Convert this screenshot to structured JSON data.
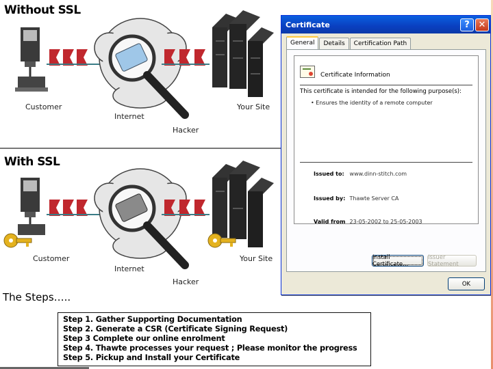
{
  "without_ssl": {
    "title": "Without SSL",
    "labels": {
      "customer": "Customer",
      "internet": "Internet",
      "hacker": "Hacker",
      "site": "Your Site"
    }
  },
  "with_ssl": {
    "title": "With SSL",
    "labels": {
      "customer": "Customer",
      "internet": "Internet",
      "hacker": "Hacker",
      "site": "Your Site"
    }
  },
  "steps": {
    "title": "The Steps…..",
    "items": [
      "Step 1. Gather Supporting Documentation",
      "Step 2. Generate a CSR (Certificate Signing Request)",
      "Step 3 Complete our online enrolment",
      "Step 4. Thawte processes your request ; Please monitor the progress",
      "Step 5. Pickup and Install your Certificate"
    ]
  },
  "dialog": {
    "title": "Certificate",
    "help_glyph": "?",
    "close_glyph": "✕",
    "tabs": [
      "General",
      "Details",
      "Certification Path"
    ],
    "info_heading": "Certificate Information",
    "purpose_label": "This certificate is intended for the following purpose(s):",
    "purpose_item": "• Ensures the identity of a remote computer",
    "issued_to_label": "Issued to:",
    "issued_to_value": "www.dinn-stitch.com",
    "issued_by_label": "Issued by:",
    "issued_by_value": "Thawte Server CA",
    "valid_label": "Valid from",
    "valid_value": "23-05-2002  to  25-05-2003",
    "install_button": "Install Certificate...",
    "issuer_button": "Issuer Statement",
    "ok_button": "OK"
  },
  "colors": {
    "packet_red": "#c0282e",
    "packet_teal": "#3a7c86",
    "key_gold": "#e4b21f",
    "titlebar_blue": "#0a4fd0"
  }
}
